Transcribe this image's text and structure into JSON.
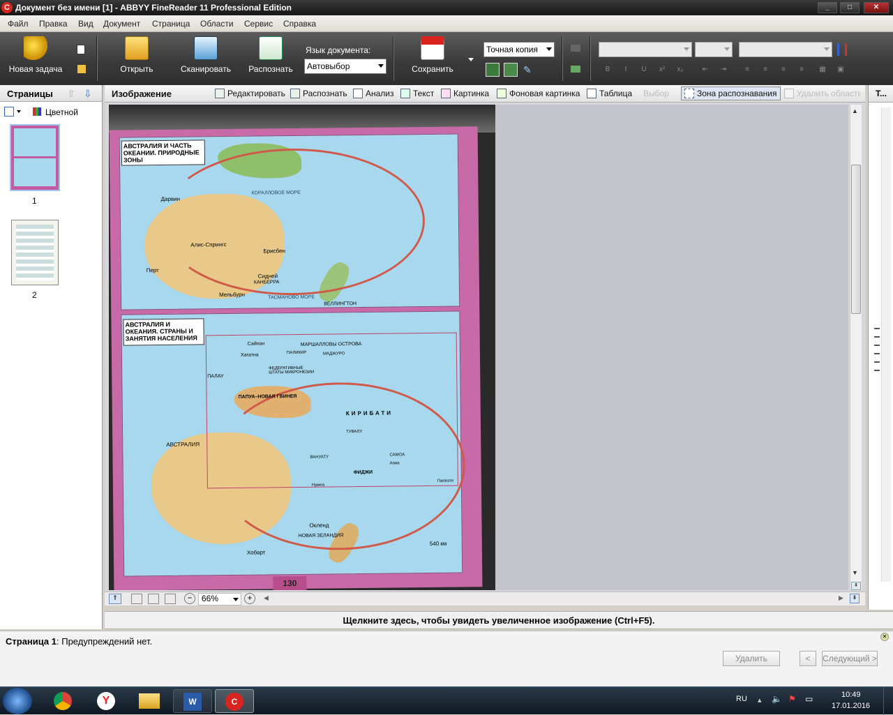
{
  "window": {
    "title": "Документ без имени [1] - ABBYY FineReader 11 Professional Edition",
    "min": "_",
    "max": "□",
    "close": "✕"
  },
  "menu": [
    "Файл",
    "Правка",
    "Вид",
    "Документ",
    "Страница",
    "Области",
    "Сервис",
    "Справка"
  ],
  "toolbar": {
    "new_task": "Новая задача",
    "open": "Открыть",
    "scan": "Сканировать",
    "recognize": "Распознать",
    "lang_label": "Язык документа:",
    "lang_value": "Автовыбор",
    "save": "Сохранить",
    "copy_mode": "Точная копия"
  },
  "pages_panel": {
    "title": "Страницы",
    "color_mode": "Цветной",
    "pages": [
      {
        "num": "1"
      },
      {
        "num": "2"
      }
    ]
  },
  "image_panel": {
    "title": "Изображение",
    "tools": [
      "Редактировать",
      "Распознать",
      "Анализ",
      "Текст",
      "Картинка",
      "Фоновая картинка",
      "Таблица",
      "Выбор",
      "Зона распознавания",
      "Удалить области"
    ],
    "zoom": "66%"
  },
  "map": {
    "top_title": "АВСТРАЛИЯ И ЧАСТЬ ОКЕАНИИ. ПРИРОДНЫЕ ЗОНЫ",
    "bottom_title": "АВСТРАЛИЯ И ОКЕАНИЯ. СТРАНЫ И ЗАНЯТИЯ НАСЕЛЕНИЯ",
    "page_num": "130",
    "labels": [
      "Дарвин",
      "Брисбен",
      "Сидней",
      "КАНБЕРРА",
      "Мельбурн",
      "ВЕЛЛИНГТОН",
      "Алис-Спрингс",
      "Перт",
      "АВСТРАЛИЯ",
      "ПАПУА–НОВАЯ ГВИНЕЯ",
      "ПАЛАУ",
      "МАРШАЛЛОВЫ ОСТРОВА",
      "Окленд",
      "НОВАЯ ЗЕЛАНДИЯ",
      "Хобарт",
      "540 км",
      "Сайпан",
      "Хагатна",
      "ФЕДЕРАТИВНЫЕ ШТАТЫ МИКРОНЕЗИИ",
      "КИРИБАТИ",
      "ТУВАЛУ",
      "ФИДЖИ",
      "ВАНУАТУ",
      "САМОА",
      "Апиа",
      "Папеэте",
      "Нумеа",
      "ПАЛИКИР",
      "МАДЖУРО",
      "КОРАЛЛОВОЕ МОРЕ",
      "ТАСМАНОВО МОРЕ"
    ]
  },
  "right_panel": {
    "label": "Т..."
  },
  "hint": "Щелкните здесь, чтобы увидеть увеличенное изображение (Ctrl+F5).",
  "status": {
    "page_label": "Страница 1",
    "message": ": Предупреждений нет.",
    "delete": "Удалить",
    "prev": "<",
    "next": "Следующий >"
  },
  "taskbar": {
    "lang": "RU",
    "time": "10:49",
    "date": "17.01.2016"
  },
  "colors": {
    "accent": "#d8231e",
    "map_border": "#c45aa0",
    "sea": "#a8d8ee",
    "land": "#e8c98a"
  }
}
